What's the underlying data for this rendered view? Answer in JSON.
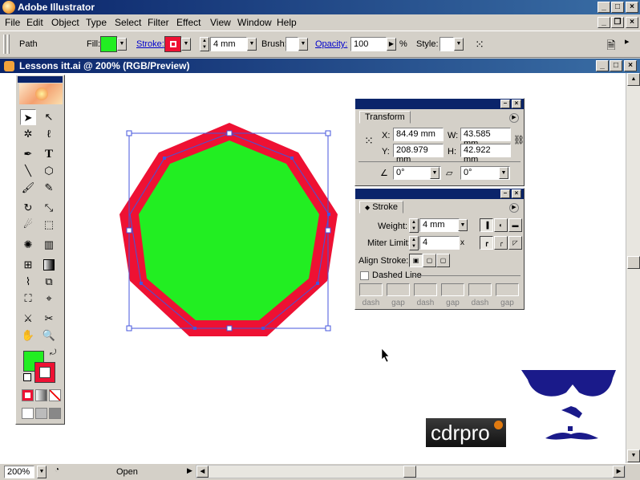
{
  "app": {
    "title": "Adobe Illustrator"
  },
  "menus": [
    "File",
    "Edit",
    "Object",
    "Type",
    "Select",
    "Filter",
    "Effect",
    "View",
    "Window",
    "Help"
  ],
  "control": {
    "object_type": "Path",
    "fill_label": "Fill:",
    "stroke_label": "Stroke:",
    "stroke_weight": "4 mm",
    "brush_label": "Brush:",
    "opacity_label": "Opacity:",
    "opacity_value": "100",
    "opacity_unit": "%",
    "style_label": "Style:"
  },
  "document": {
    "title": "Lessons itt.ai @ 200% (RGB/Preview)"
  },
  "colors": {
    "fill": "#22ee22",
    "stroke": "#ee1133",
    "selection": "#4455dd",
    "accent": "#0a246a",
    "mascot": "#1a1a8a"
  },
  "transform_panel": {
    "tab": "Transform",
    "x_label": "X:",
    "x_value": "84.49 mm",
    "y_label": "Y:",
    "y_value": "208.979 mm",
    "w_label": "W:",
    "w_value": "43.585 mm",
    "h_label": "H:",
    "h_value": "42.922 mm",
    "rotate_value": "0°",
    "shear_value": "0°"
  },
  "stroke_panel": {
    "tab": "Stroke",
    "weight_label": "Weight:",
    "weight_value": "4 mm",
    "miter_label": "Miter Limit:",
    "miter_value": "4",
    "miter_unit": "x",
    "align_label": "Align Stroke:",
    "dashed_label": "Dashed Line",
    "dash_labels": [
      "dash",
      "gap",
      "dash",
      "gap",
      "dash",
      "gap"
    ]
  },
  "status": {
    "zoom": "200%",
    "text": "Open"
  },
  "logo": {
    "text": "cdrpro"
  },
  "icons": [
    "selection-tool-icon",
    "direct-selection-icon",
    "magic-wand-icon",
    "lasso-icon",
    "pen-icon",
    "type-icon",
    "line-icon",
    "polygon-icon",
    "paintbrush-icon",
    "pencil-icon",
    "rotate-icon",
    "scale-icon",
    "warp-icon",
    "free-transform-icon",
    "symbol-sprayer-icon",
    "graph-icon",
    "mesh-icon",
    "gradient-icon",
    "eyedropper-icon",
    "blend-icon",
    "live-paint-icon",
    "live-paint-selection-icon",
    "slice-icon",
    "scissors-icon",
    "hand-icon",
    "zoom-icon"
  ]
}
